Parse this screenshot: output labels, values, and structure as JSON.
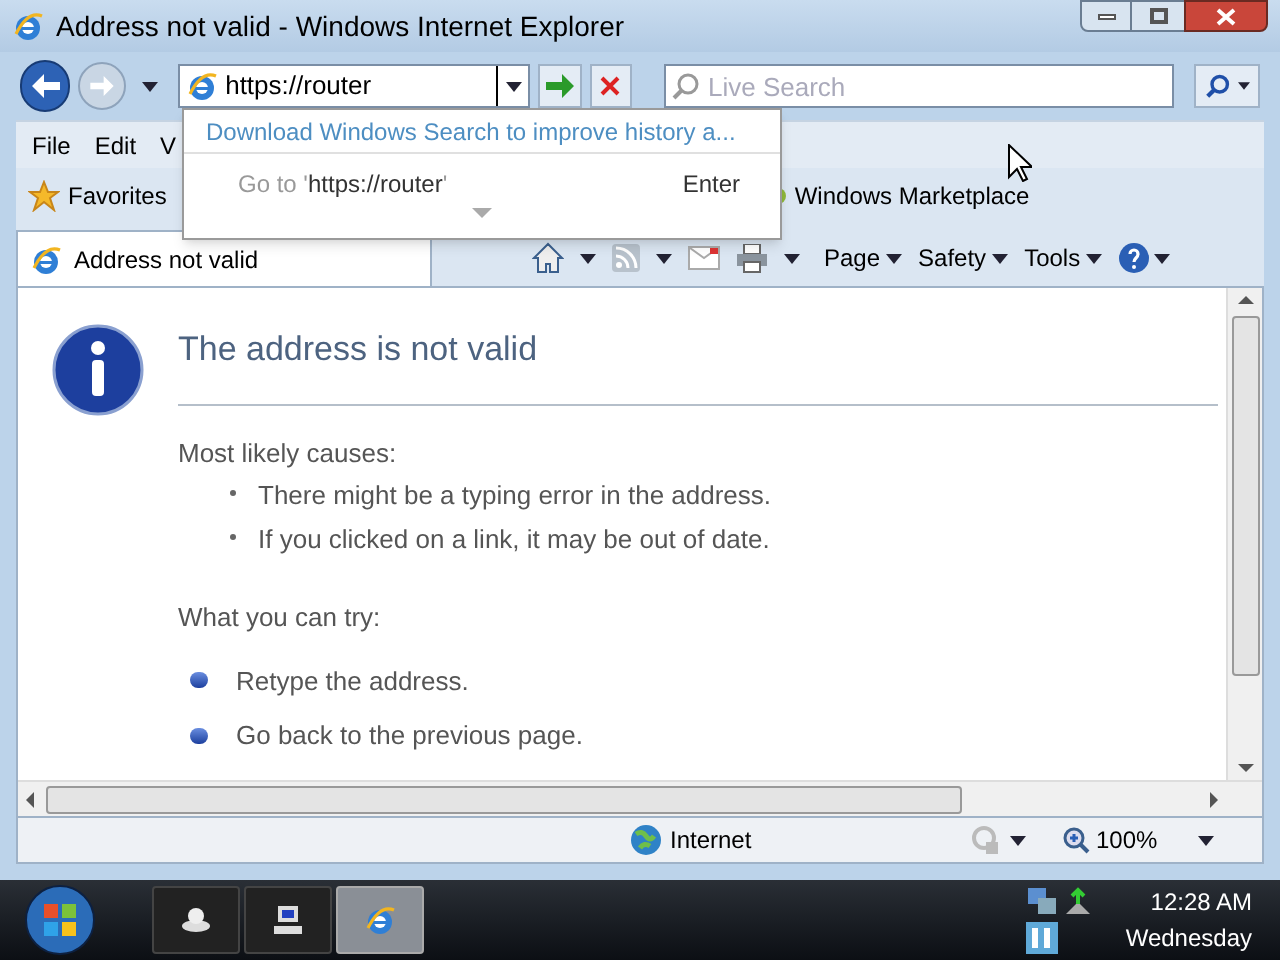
{
  "window": {
    "title": "Address not valid - Windows Internet Explorer"
  },
  "address_bar": {
    "value": "https://router"
  },
  "search": {
    "placeholder": "Live Search"
  },
  "autocomplete": {
    "link": "Download Windows Search to improve history a...",
    "goto_prefix": "Go to '",
    "goto_url": "https://router",
    "goto_suffix": "'",
    "shortcut": "Enter"
  },
  "menu": [
    "File",
    "Edit",
    "V"
  ],
  "favorites_bar": {
    "label": "Favorites",
    "link": "Windows Marketplace"
  },
  "tabs": [
    {
      "label": "Address not valid",
      "selected": true
    }
  ],
  "command_bar": [
    "Page",
    "Safety",
    "Tools"
  ],
  "page": {
    "heading": "The address is not valid",
    "causes_title": "Most likely causes:",
    "causes": [
      "There might be a typing error in the address.",
      "If you clicked on a link, it may be out of date."
    ],
    "try_title": "What you can try:",
    "tries": [
      "Retype the address.",
      "Go back to the previous page."
    ]
  },
  "status_bar": {
    "zone": "Internet",
    "zoom": "100%"
  },
  "taskbar": {
    "time": "12:28 AM",
    "day": "Wednesday"
  }
}
